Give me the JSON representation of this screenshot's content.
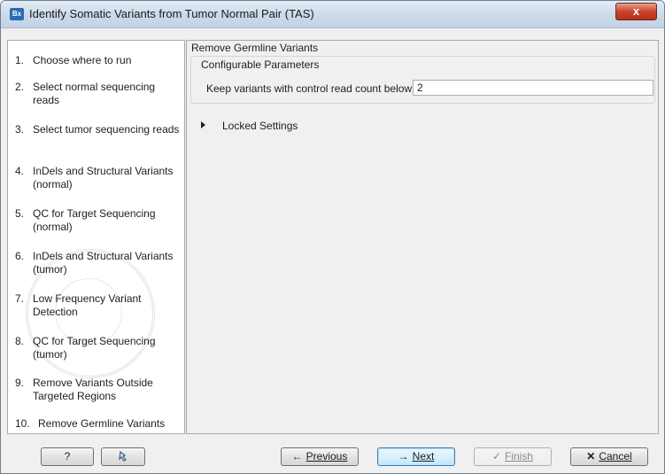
{
  "window": {
    "title": "Identify Somatic Variants from Tumor Normal Pair (TAS)",
    "icon_text": "Bx",
    "close_symbol": "x"
  },
  "sidebar": {
    "steps": [
      {
        "num": "1.",
        "label": "Choose where to run"
      },
      {
        "num": "2.",
        "label": "Select normal sequencing reads"
      },
      {
        "num": "3.",
        "label": "Select tumor sequencing reads"
      },
      {
        "num": "4.",
        "label": "InDels and Structural Variants (normal)"
      },
      {
        "num": "5.",
        "label": "QC for Target Sequencing (normal)"
      },
      {
        "num": "6.",
        "label": "InDels and Structural Variants (tumor)"
      },
      {
        "num": "7.",
        "label": "Low Frequency Variant Detection"
      },
      {
        "num": "8.",
        "label": "QC for Target Sequencing (tumor)"
      },
      {
        "num": "9.",
        "label": "Remove Variants Outside Targeted Regions"
      },
      {
        "num": "10.",
        "label": "Remove Germline Variants"
      }
    ]
  },
  "main": {
    "section_title": "Remove Germline Variants",
    "group_title": "Configurable Parameters",
    "param_label": "Keep variants with control read count below",
    "param_value": "2",
    "locked_label": "Locked Settings"
  },
  "footer": {
    "help_label": "?",
    "previous_label": "Previous",
    "next_label": "Next",
    "finish_label": "Finish",
    "cancel_label": "Cancel"
  },
  "icons": {
    "help": "question-icon",
    "reset": "reset-icon",
    "previous": "arrow-left-icon",
    "next": "arrow-right-icon",
    "finish": "checkmark-icon",
    "cancel": "cross-icon"
  }
}
